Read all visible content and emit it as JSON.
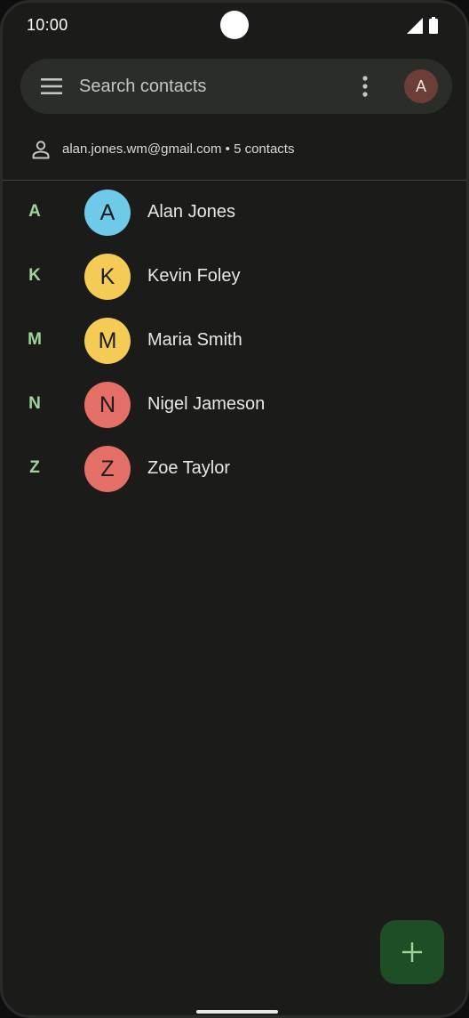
{
  "status_bar": {
    "time": "10:00"
  },
  "search": {
    "placeholder": "Search contacts",
    "avatar_letter": "A"
  },
  "account": {
    "email": "alan.jones.wm@gmail.com",
    "separator": "•",
    "count": "5 contacts"
  },
  "contacts": [
    {
      "section": "A",
      "initial": "A",
      "name": "Alan Jones",
      "color": "#6ecae8"
    },
    {
      "section": "K",
      "initial": "K",
      "name": "Kevin Foley",
      "color": "#f4cb55"
    },
    {
      "section": "M",
      "initial": "M",
      "name": "Maria Smith",
      "color": "#f4cb55"
    },
    {
      "section": "N",
      "initial": "N",
      "name": "Nigel Jameson",
      "color": "#e36f66"
    },
    {
      "section": "Z",
      "initial": "Z",
      "name": "Zoe Taylor",
      "color": "#e36f66"
    }
  ],
  "colors": {
    "background": "#1b1c1a",
    "section_letter": "#9fd49b",
    "fab": "#1f4d26",
    "fab_icon": "#9fd49b"
  },
  "icons": {
    "menu": "menu-icon",
    "more": "more-vertical-icon",
    "account": "person-icon",
    "fab": "plus-icon"
  }
}
